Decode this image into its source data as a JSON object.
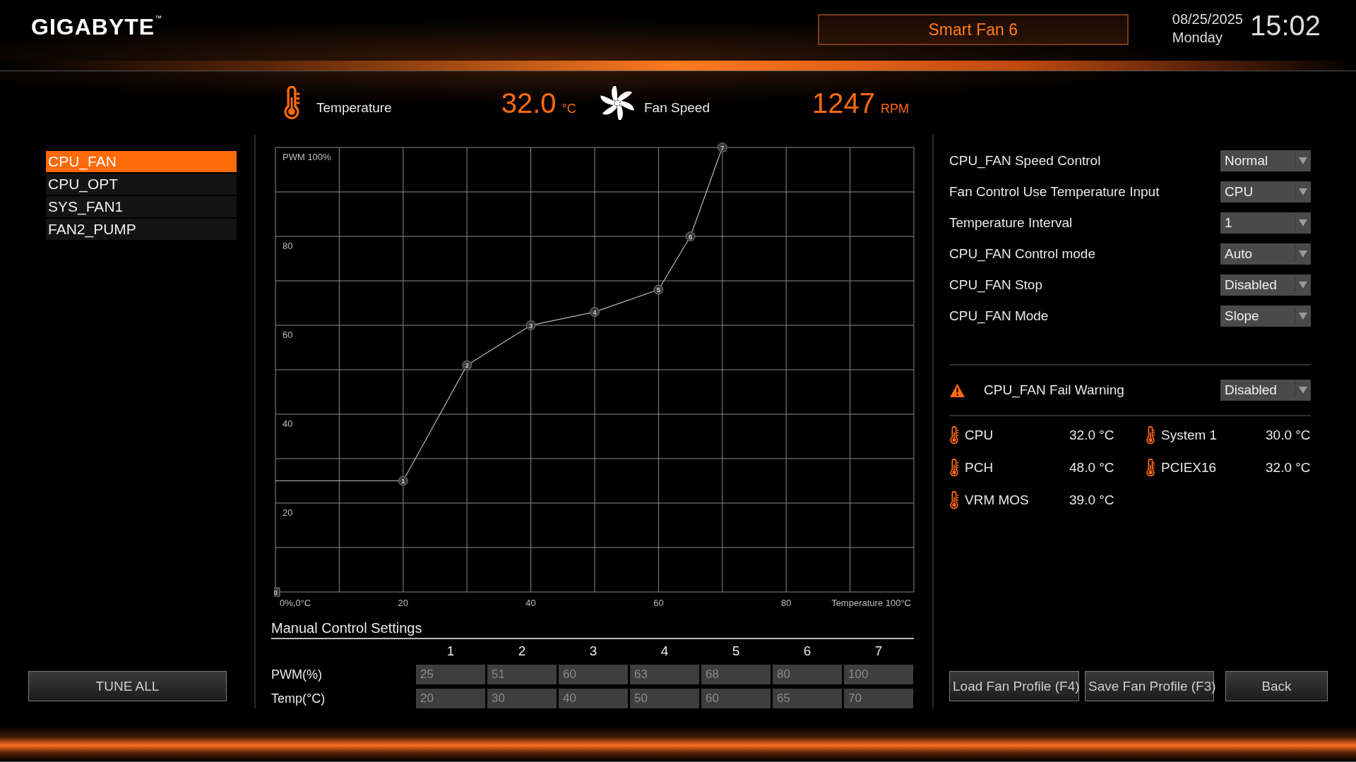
{
  "header": {
    "logo": "GIGABYTE",
    "logo_mark": "™",
    "title": "Smart Fan 6",
    "date": "08/25/2025",
    "weekday": "Monday",
    "time": "15:02"
  },
  "readings": [
    {
      "kind": "temperature",
      "label": "Temperature",
      "value": "32.0",
      "unit": "°C"
    },
    {
      "kind": "fan",
      "label": "Fan Speed",
      "value": "1247",
      "unit": "RPM"
    }
  ],
  "fans": [
    {
      "label": "CPU_FAN",
      "selected": true
    },
    {
      "label": "CPU_OPT",
      "selected": false
    },
    {
      "label": "SYS_FAN1",
      "selected": false
    },
    {
      "label": "FAN2_PUMP",
      "selected": false
    }
  ],
  "tune_all": "TUNE ALL",
  "chart": {
    "chart_data": {
      "type": "line",
      "x": [
        0,
        20,
        30,
        40,
        50,
        60,
        65,
        70
      ],
      "xlim": [
        0,
        100
      ],
      "ylim": [
        0,
        100
      ],
      "grid": true,
      "series": [
        {
          "color": "#bbbbbb",
          "marker": "circle",
          "values": [
            25,
            25,
            51,
            60,
            63,
            68,
            80,
            100
          ]
        }
      ],
      "xticks": [
        {
          "value": 0,
          "label": "0%,0°C"
        },
        20,
        40,
        60,
        80,
        {
          "value": 100,
          "label": "Temperature 100°C"
        }
      ],
      "yticks": [
        20,
        40,
        60,
        80,
        {
          "value": 100,
          "label": "PWM 100%"
        }
      ],
      "annotations": [
        {
          "x": 0,
          "y": 0,
          "text": "0"
        },
        {
          "x": 20,
          "y": 25,
          "text": "1"
        },
        {
          "x": 30,
          "y": 51,
          "text": "2"
        },
        {
          "x": 40,
          "y": 60,
          "text": "3"
        },
        {
          "x": 50,
          "y": 63,
          "text": "4"
        },
        {
          "x": 60,
          "y": 68,
          "text": "5"
        },
        {
          "x": 65,
          "y": 80,
          "text": "6"
        },
        {
          "x": 70,
          "y": 100,
          "text": "7"
        }
      ]
    }
  },
  "manual": {
    "title": "Manual Control Settings",
    "columns": [
      "1",
      "2",
      "3",
      "4",
      "5",
      "6",
      "7"
    ],
    "rows": [
      {
        "label": "PWM(%)",
        "values": [
          "25",
          "51",
          "60",
          "63",
          "68",
          "80",
          "100"
        ]
      },
      {
        "label": "Temp(°C)",
        "values": [
          "20",
          "30",
          "40",
          "50",
          "60",
          "65",
          "70"
        ]
      }
    ]
  },
  "settings": [
    {
      "label": "CPU_FAN Speed Control",
      "value": "Normal"
    },
    {
      "label": "Fan Control Use Temperature Input",
      "value": "CPU"
    },
    {
      "label": "Temperature Interval",
      "value": "1"
    },
    {
      "label": "CPU_FAN Control mode",
      "value": "Auto"
    },
    {
      "label": "CPU_FAN Stop",
      "value": "Disabled"
    },
    {
      "label": "CPU_FAN Mode",
      "value": "Slope"
    }
  ],
  "fail_warning": {
    "label": "CPU_FAN Fail Warning",
    "value": "Disabled"
  },
  "temperatures": [
    {
      "label": "CPU",
      "value": "32.0 °C"
    },
    {
      "label": "System 1",
      "value": "30.0 °C"
    },
    {
      "label": "PCH",
      "value": "48.0 °C"
    },
    {
      "label": "PCIEX16",
      "value": "32.0 °C"
    },
    {
      "label": "VRM MOS",
      "value": "39.0 °C"
    }
  ],
  "buttons": [
    "Load Fan Profile (F4)",
    "Save Fan Profile (F3)",
    "Back"
  ]
}
